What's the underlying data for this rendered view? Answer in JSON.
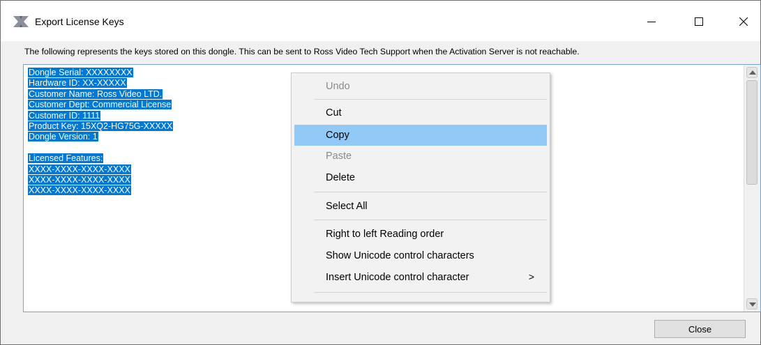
{
  "window": {
    "title": "Export License Keys",
    "controls": {
      "minimize": "minimize-icon",
      "maximize": "maximize-icon",
      "close": "close-icon"
    }
  },
  "description": "The following represents the keys stored on this dongle.  This can be sent to Ross Video Tech Support when the Activation Server is not reachable.",
  "license_text": {
    "lines": [
      "Dongle Serial: XXXXXXXX",
      "Hardware ID: XX-XXXXX",
      "Customer Name: Ross Video LTD.",
      "Customer Dept: Commercial License",
      "Customer ID: 1111",
      "Product Key: 15XQ2-HG75G-XXXXX",
      "Dongle Version: 1",
      "",
      "Licensed Features:",
      "XXXX-XXXX-XXXX-XXXX",
      "XXXX-XXXX-XXXX-XXXX",
      "XXXX-XXXX-XXXX-XXXX"
    ]
  },
  "context_menu": {
    "items": [
      {
        "label": "Undo",
        "enabled": false
      },
      {
        "label": "Cut",
        "enabled": true
      },
      {
        "label": "Copy",
        "enabled": true,
        "highlighted": true
      },
      {
        "label": "Paste",
        "enabled": false
      },
      {
        "label": "Delete",
        "enabled": true
      },
      {
        "label": "Select All",
        "enabled": true
      },
      {
        "label": "Right to left Reading order",
        "enabled": true
      },
      {
        "label": "Show Unicode control characters",
        "enabled": true
      },
      {
        "label": "Insert Unicode control character",
        "enabled": true,
        "submenu": true
      }
    ],
    "submenu_arrow": ">"
  },
  "buttons": {
    "close": "Close"
  },
  "colors": {
    "selection": "#0078d7",
    "menu_highlight": "#91c9f7"
  }
}
